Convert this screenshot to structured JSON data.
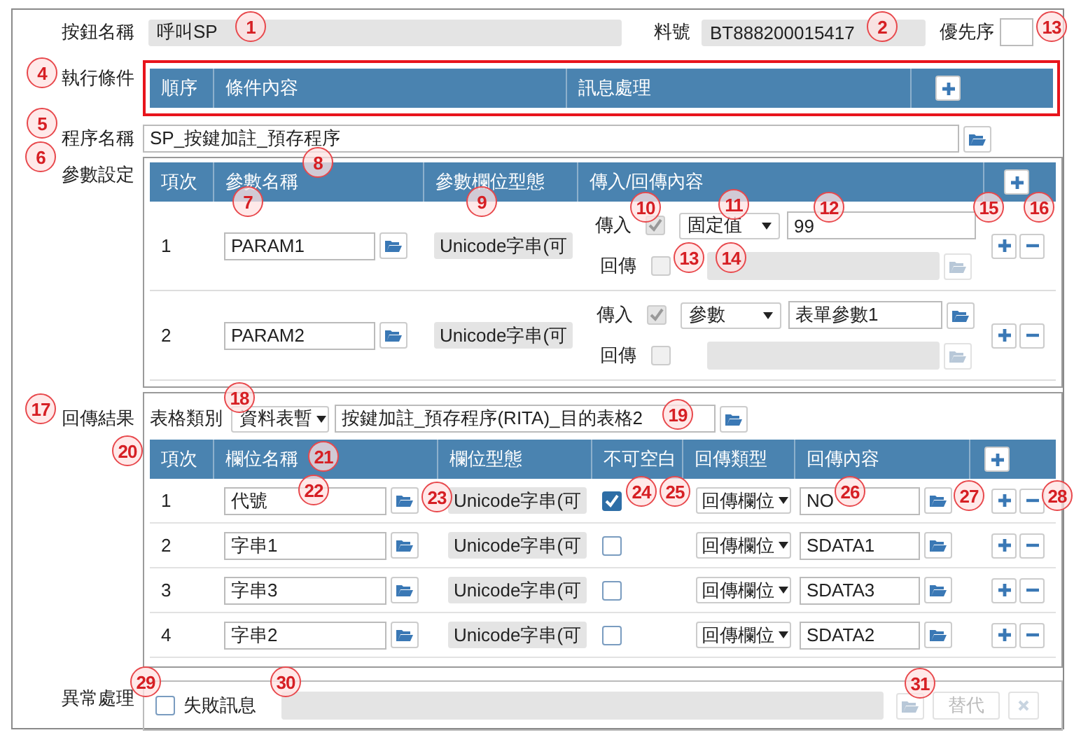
{
  "header": {
    "button_name_label": "按鈕名稱",
    "button_name": "呼叫SP",
    "part_no_label": "料號",
    "part_no": "BT888200015417",
    "priority_label": "優先序"
  },
  "conditions": {
    "label": "執行條件",
    "highlighted": true,
    "columns": [
      "順序",
      "條件內容",
      "訊息處理"
    ]
  },
  "procedure": {
    "label": "程序名稱",
    "value": "SP_按鍵加註_預存程序"
  },
  "params": {
    "label": "參數設定",
    "columns": [
      "項次",
      "參數名稱",
      "參數欄位型態",
      "傳入/回傳內容"
    ],
    "rows": [
      {
        "index": "1",
        "name": "PARAM1",
        "type": "Unicode字串(可",
        "in_label": "傳入",
        "in_checked": true,
        "in_mode": "固定值",
        "in_value": "99",
        "in_browse": false,
        "out_label": "回傳",
        "out_checked": false
      },
      {
        "index": "2",
        "name": "PARAM2",
        "type": "Unicode字串(可",
        "in_label": "傳入",
        "in_checked": true,
        "in_mode": "參數",
        "in_value": "表單參數1",
        "in_browse": true,
        "out_label": "回傳",
        "out_checked": false
      }
    ]
  },
  "results": {
    "label": "回傳結果",
    "table_type_label": "表格類別",
    "table_type": "資料表暫",
    "table_name": "按鍵加註_預存程序(RITA)_目的表格2",
    "columns": [
      "項次",
      "欄位名稱",
      "欄位型態",
      "不可空白",
      "回傳類型",
      "回傳內容"
    ],
    "rows": [
      {
        "index": "1",
        "name": "代號",
        "type": "Unicode字串(可",
        "required": true,
        "return_type": "回傳欄位",
        "return_value": "NO"
      },
      {
        "index": "2",
        "name": "字串1",
        "type": "Unicode字串(可",
        "required": false,
        "return_type": "回傳欄位",
        "return_value": "SDATA1"
      },
      {
        "index": "3",
        "name": "字串3",
        "type": "Unicode字串(可",
        "required": false,
        "return_type": "回傳欄位",
        "return_value": "SDATA3"
      },
      {
        "index": "4",
        "name": "字串2",
        "type": "Unicode字串(可",
        "required": false,
        "return_type": "回傳欄位",
        "return_value": "SDATA2"
      }
    ]
  },
  "exception": {
    "label": "異常處理",
    "checked": false,
    "fail_label": "失敗訊息",
    "replace_button": "替代",
    "enabled": false
  },
  "annotations": [
    "1",
    "2",
    "13",
    "4",
    "5",
    "6",
    "8",
    "7",
    "9",
    "10",
    "11",
    "12",
    "13",
    "14",
    "15",
    "16",
    "17",
    "18",
    "19",
    "20",
    "21",
    "22",
    "23",
    "24",
    "25",
    "26",
    "27",
    "28",
    "29",
    "30",
    "31"
  ]
}
